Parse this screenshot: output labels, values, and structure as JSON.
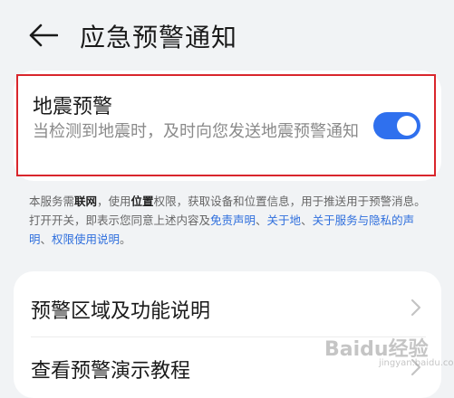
{
  "header": {
    "title": "应急预警通知",
    "back_icon": "back-arrow-icon"
  },
  "earthquake": {
    "title": "地震预警",
    "description": "当检测到地震时，及时向您发送地震预警通知",
    "toggle_on": true,
    "toggle_color": "#2f70ee",
    "highlight_color": "#d9262c"
  },
  "notice": {
    "p1": "本服务需",
    "b1": "联网",
    "p2": "，使用",
    "b2": "位置",
    "p3": "权限，获取设备和位置信息，用于推送",
    "p4": "用于预警消息。打开开关，即表示您同意上述内容及",
    "l1": "免责声明",
    "s1": "、",
    "l2": "关于地",
    "s2": "、",
    "l3": "关于服务与隐私的声明",
    "s3": "、",
    "l4": "权限使用说明",
    "end": "。"
  },
  "menu": {
    "items": [
      {
        "label": "预警区域及功能说明"
      },
      {
        "label": "查看预警演示教程"
      }
    ]
  },
  "watermark": {
    "text": "Baidu经验",
    "sub": "jingyan.baidu.com"
  }
}
